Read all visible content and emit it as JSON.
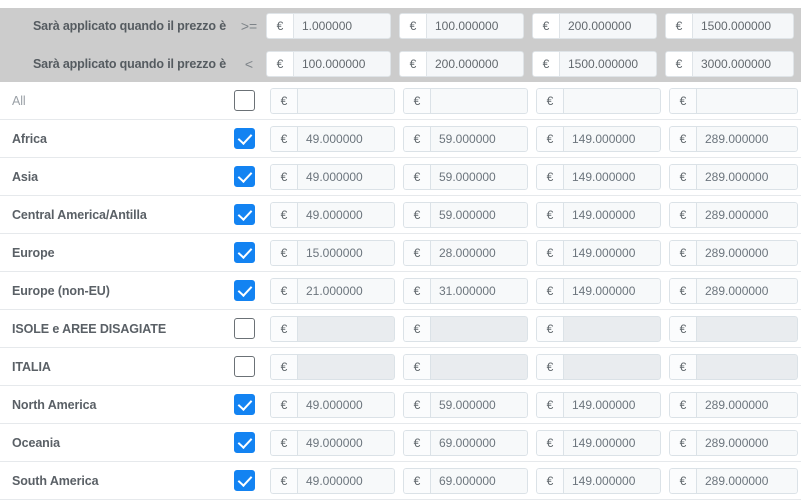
{
  "header": {
    "rows": [
      {
        "label": "Sarà applicato quando il prezzo è",
        "operator": ">=",
        "values": [
          "1.000000",
          "100.000000",
          "200.000000",
          "1500.000000"
        ]
      },
      {
        "label": "Sarà applicato quando il prezzo è",
        "operator": "<",
        "values": [
          "100.000000",
          "200.000000",
          "1500.000000",
          "3000.000000"
        ]
      }
    ]
  },
  "currency_symbol": "€",
  "colors": {
    "header_background": "#cccccc",
    "checkbox_checked": "#1383f2",
    "input_disabled": "#e9ecef",
    "row_border": "#e6e9ec"
  },
  "rows": [
    {
      "label": "All",
      "checked": false,
      "disabled": false,
      "muted": true,
      "values": [
        "",
        "",
        "",
        ""
      ]
    },
    {
      "label": "Africa",
      "checked": true,
      "disabled": false,
      "muted": false,
      "values": [
        "49.000000",
        "59.000000",
        "149.000000",
        "289.000000"
      ]
    },
    {
      "label": "Asia",
      "checked": true,
      "disabled": false,
      "muted": false,
      "values": [
        "49.000000",
        "59.000000",
        "149.000000",
        "289.000000"
      ]
    },
    {
      "label": "Central America/Antilla",
      "checked": true,
      "disabled": false,
      "muted": false,
      "values": [
        "49.000000",
        "59.000000",
        "149.000000",
        "289.000000"
      ]
    },
    {
      "label": "Europe",
      "checked": true,
      "disabled": false,
      "muted": false,
      "values": [
        "15.000000",
        "28.000000",
        "149.000000",
        "289.000000"
      ]
    },
    {
      "label": "Europe (non-EU)",
      "checked": true,
      "disabled": false,
      "muted": false,
      "values": [
        "21.000000",
        "31.000000",
        "149.000000",
        "289.000000"
      ]
    },
    {
      "label": "ISOLE e AREE DISAGIATE",
      "checked": false,
      "disabled": true,
      "muted": false,
      "values": [
        "",
        "",
        "",
        ""
      ]
    },
    {
      "label": "ITALIA",
      "checked": false,
      "disabled": true,
      "muted": false,
      "values": [
        "",
        "",
        "",
        ""
      ]
    },
    {
      "label": "North America",
      "checked": true,
      "disabled": false,
      "muted": false,
      "values": [
        "49.000000",
        "59.000000",
        "149.000000",
        "289.000000"
      ]
    },
    {
      "label": "Oceania",
      "checked": true,
      "disabled": false,
      "muted": false,
      "values": [
        "49.000000",
        "69.000000",
        "149.000000",
        "289.000000"
      ]
    },
    {
      "label": "South America",
      "checked": true,
      "disabled": false,
      "muted": false,
      "values": [
        "49.000000",
        "69.000000",
        "149.000000",
        "289.000000"
      ]
    }
  ]
}
